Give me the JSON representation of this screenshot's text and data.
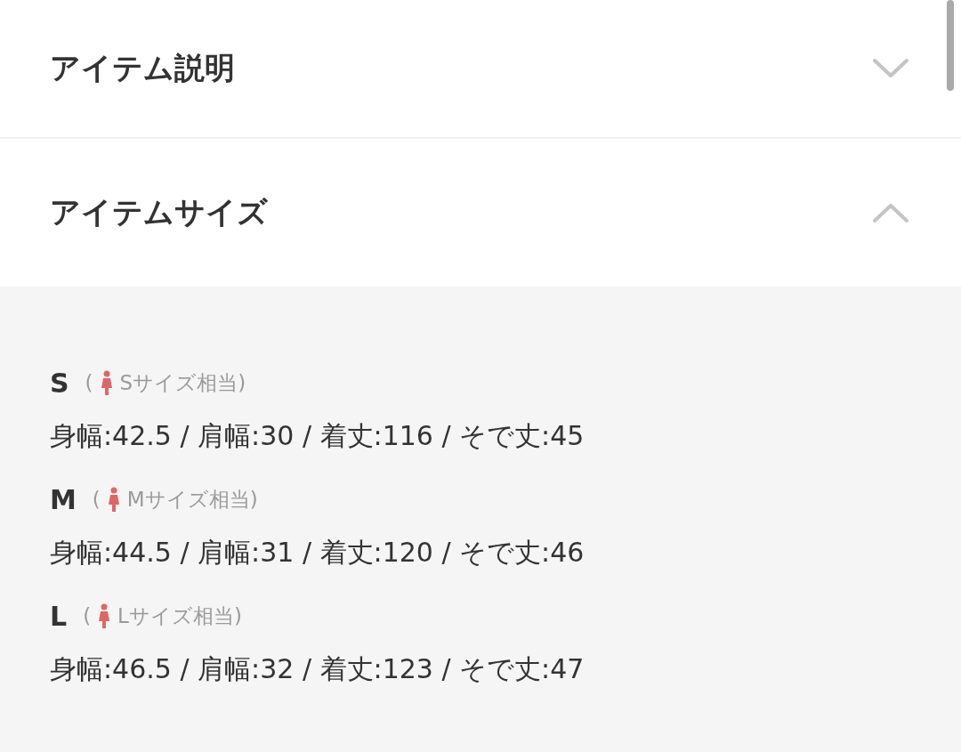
{
  "sections": [
    {
      "title": "アイテム説明",
      "expanded": false
    },
    {
      "title": "アイテムサイズ",
      "expanded": true
    }
  ],
  "sizes": [
    {
      "size": "S",
      "open_paren": "(",
      "note": "Sサイズ相当)",
      "measurements": "身幅:42.5 / 肩幅:30 / 着丈:116 / そで丈:45"
    },
    {
      "size": "M",
      "open_paren": "(",
      "note": "Mサイズ相当)",
      "measurements": "身幅:44.5 / 肩幅:31 / 着丈:120 / そで丈:46"
    },
    {
      "size": "L",
      "open_paren": "(",
      "note": "Lサイズ相当)",
      "measurements": "身幅:46.5 / 肩幅:32 / 着丈:123 / そで丈:47"
    }
  ]
}
